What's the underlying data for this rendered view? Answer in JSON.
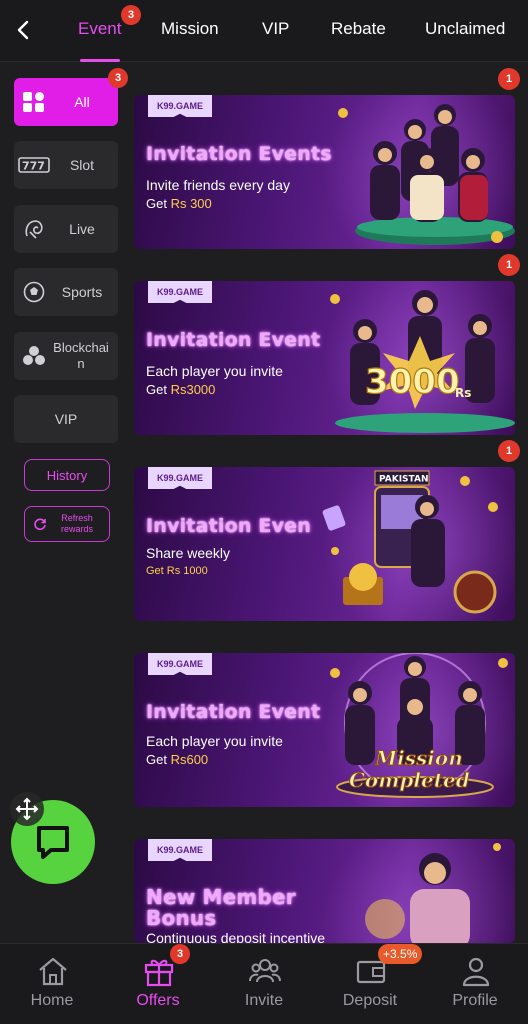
{
  "top_nav": {
    "tabs": [
      {
        "label": "Event",
        "badge": "3"
      },
      {
        "label": "Mission"
      },
      {
        "label": "VIP"
      },
      {
        "label": "Rebate"
      },
      {
        "label": "Unclaimed"
      }
    ]
  },
  "sidebar": {
    "items": [
      {
        "label": "All",
        "icon": "grid-icon",
        "badge": "3"
      },
      {
        "label": "Slot",
        "icon": "slot-777-icon"
      },
      {
        "label": "Live",
        "icon": "live-dealer-icon"
      },
      {
        "label": "Sports",
        "icon": "soccer-ball-icon"
      },
      {
        "label": "Blockchai n",
        "icon": "blockchain-icon"
      },
      {
        "label": "VIP"
      }
    ],
    "history_label": "History",
    "refresh_label": "Refresh rewards"
  },
  "cards": [
    {
      "brand": "K99.GAME",
      "title": "Invitation Events",
      "desc": "Invite friends every day",
      "sub_prefix": "Get ",
      "sub_value": "Rs 300",
      "badge": "1"
    },
    {
      "brand": "K99.GAME",
      "title": "Invitation Event",
      "desc": "Each player you invite",
      "sub_prefix": "Get ",
      "sub_value": "Rs3000",
      "badge": "1",
      "art_text": "3000",
      "art_unit": "Rs"
    },
    {
      "brand": "K99.GAME",
      "title": "Invitation Even",
      "desc": "Share weekly",
      "sub_prefix": "",
      "sub_value": "Get Rs 1000",
      "badge": "1",
      "art_text": "PAKISTAN"
    },
    {
      "brand": "K99.GAME",
      "title": "Invitation Event",
      "desc": "Each player you invite",
      "sub_prefix": "Get ",
      "sub_value": "Rs600",
      "art_text": "Mission",
      "art_text2": "Completed"
    },
    {
      "brand": "K99.GAME",
      "title": "New Member",
      "title2": "Bonus",
      "desc": "Continuous deposit incentive"
    }
  ],
  "bottom_nav": {
    "items": [
      {
        "label": "Home",
        "icon": "home-icon"
      },
      {
        "label": "Offers",
        "icon": "gift-icon",
        "badge": "3"
      },
      {
        "label": "Invite",
        "icon": "invite-icon"
      },
      {
        "label": "Deposit",
        "icon": "wallet-icon",
        "badge": "+3.5%"
      },
      {
        "label": "Profile",
        "icon": "profile-icon"
      }
    ]
  },
  "colors": {
    "accent": "#e64cf0",
    "badge": "#e0392b",
    "chat": "#56d33f"
  }
}
